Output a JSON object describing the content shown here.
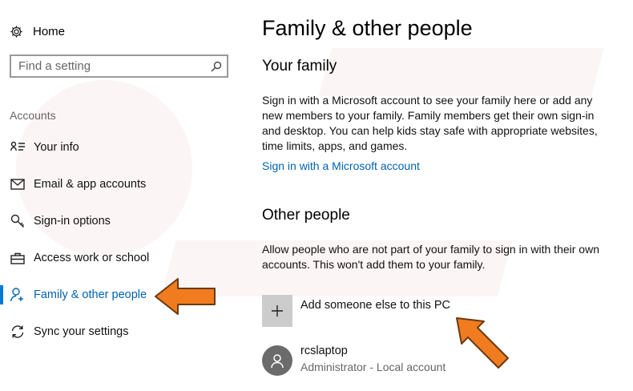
{
  "sidebar": {
    "home_label": "Home",
    "search_placeholder": "Find a setting",
    "section_label": "Accounts",
    "items": [
      {
        "label": "Your info",
        "icon": "person-card-icon"
      },
      {
        "label": "Email & app accounts",
        "icon": "mail-icon"
      },
      {
        "label": "Sign-in options",
        "icon": "key-icon"
      },
      {
        "label": "Access work or school",
        "icon": "briefcase-icon"
      },
      {
        "label": "Family & other people",
        "icon": "person-icon",
        "active": true
      },
      {
        "label": "Sync your settings",
        "icon": "sync-icon"
      }
    ]
  },
  "main": {
    "title": "Family & other people",
    "your_family": {
      "heading": "Your family",
      "description": "Sign in with a Microsoft account to see your family here or add any new members to your family. Family members get their own sign-in and desktop. You can help kids stay safe with appropriate websites, time limits, apps, and games.",
      "link": "Sign in with a Microsoft account"
    },
    "other_people": {
      "heading": "Other people",
      "description": "Allow people who are not part of your family to sign in with their own accounts. This won't add them to your family.",
      "add_label": "Add someone else to this PC",
      "account": {
        "name": "rcslaptop",
        "role": "Administrator - Local account"
      }
    }
  },
  "colors": {
    "accent": "#0078d7",
    "link": "#0063b1",
    "arrow": "#f07c1f",
    "plus_box": "#cccccc",
    "avatar": "#6b6b6b"
  }
}
